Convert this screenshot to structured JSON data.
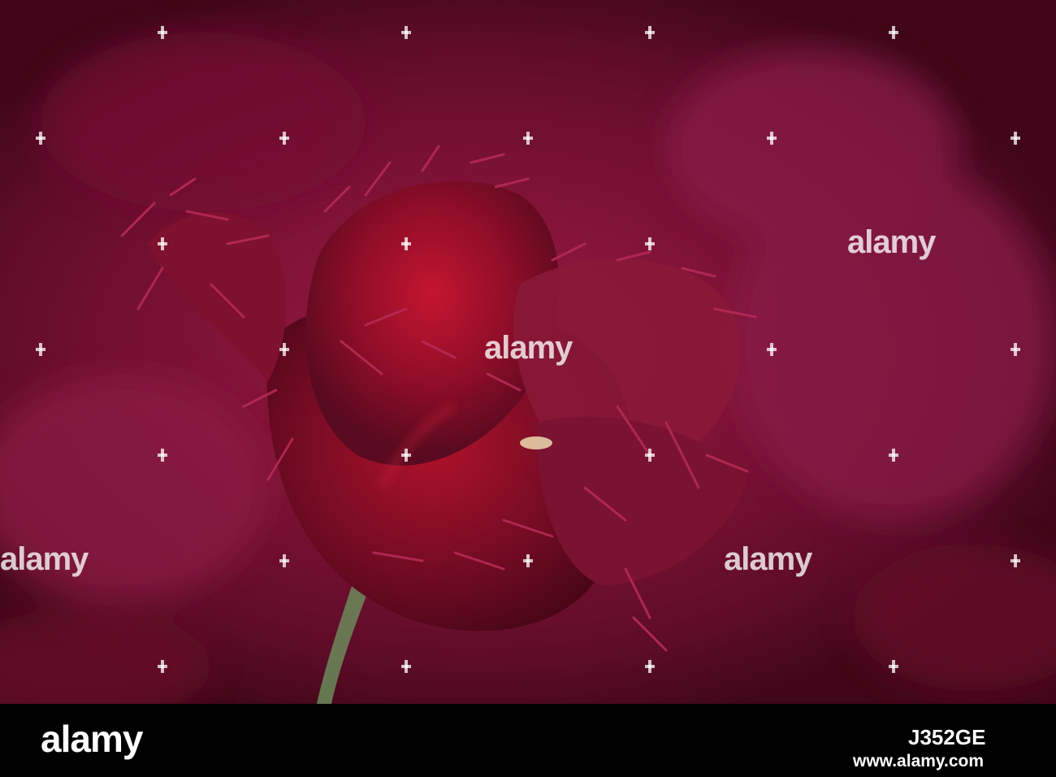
{
  "image": {
    "subject": "fringed-tulip",
    "background_color": "#7d1236",
    "petal_color": "#8a1030",
    "stem_color": "#6b8a5a"
  },
  "watermark": {
    "logo_text": "alamy",
    "icon": "plus-icon"
  },
  "footer": {
    "logo_text": "alamy",
    "image_id": "J352GE",
    "url": "www.alamy.com"
  }
}
